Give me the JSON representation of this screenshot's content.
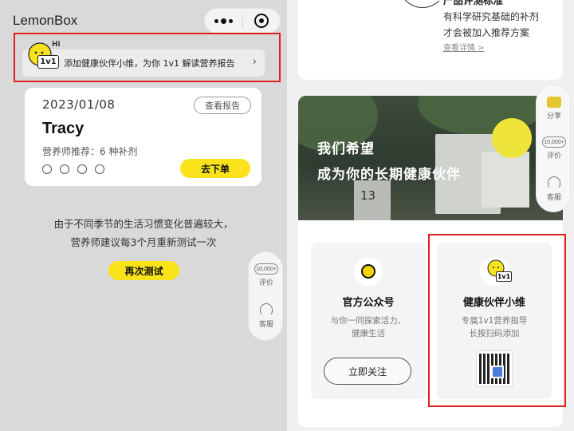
{
  "left": {
    "app_title": "LemonBox",
    "banner": {
      "hi": "Hi",
      "tag": "1v1",
      "text": "添加健康伙伴小维，为你 1v1 解读营养报告",
      "arrow": "›"
    },
    "card": {
      "date": "2023/01/08",
      "report_button": "查看报告",
      "name": "Tracy",
      "subtitle": "营养师推荐：6 种补剂",
      "order_button": "去下单"
    },
    "note_line1": "由于不同季节的生活习惯变化普遍较大，",
    "note_line2": "营养师建议每3个月重新测试一次",
    "retest_button": "再次测试",
    "float": {
      "review_badge": "10,000+",
      "review_label": "评价",
      "service_label": "客服"
    }
  },
  "right": {
    "criteria": {
      "title": "产品评测标准",
      "desc_line1": "有科学研究基础的补剂",
      "desc_line2": "才会被加入推荐方案",
      "link": "查看详情 >"
    },
    "hero": {
      "line1": "我们希望",
      "line2": "成为你的长期健康伙伴",
      "box_number": "13"
    },
    "official": {
      "title": "官方公众号",
      "line1": "与你一同探索活力、",
      "line2": "健康生活",
      "button": "立即关注"
    },
    "partner": {
      "tag": "1v1",
      "title": "健康伙伴小维",
      "line1": "专属1v1营养指导",
      "line2": "长按扫码添加"
    },
    "float": {
      "share_label": "分享",
      "review_badge": "10,000+",
      "review_label": "评价",
      "service_label": "客服"
    }
  },
  "colors": {
    "accent_yellow": "#fae31a",
    "highlight_red": "#e02020"
  }
}
